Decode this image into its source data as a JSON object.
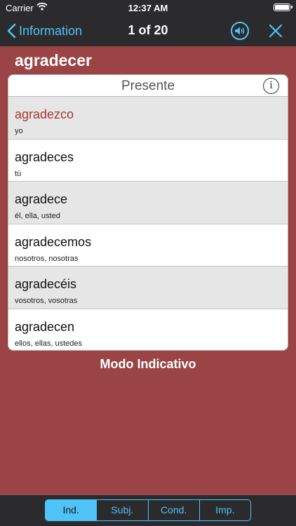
{
  "status_bar": {
    "carrier": "Carrier",
    "time": "12:37 AM"
  },
  "nav": {
    "back_label": "Information",
    "counter": "1 of 20",
    "speaker_icon": "speaker-icon",
    "close_icon": "close-icon"
  },
  "verb": "agradecer",
  "table": {
    "tense": "Presente",
    "info_glyph": "i",
    "rows": [
      {
        "form": "agradezco",
        "pronoun": "yo",
        "irregular": true
      },
      {
        "form": "agradeces",
        "pronoun": "tú",
        "irregular": false
      },
      {
        "form": "agradece",
        "pronoun": "él, ella, usted",
        "irregular": false
      },
      {
        "form": "agradecemos",
        "pronoun": "nosotros, nosotras",
        "irregular": false
      },
      {
        "form": "agradecéis",
        "pronoun": "vosotros, vosotras",
        "irregular": false
      },
      {
        "form": "agradecen",
        "pronoun": "ellos, ellas, ustedes",
        "irregular": false
      }
    ]
  },
  "mode_label": "Modo Indicativo",
  "tabs": [
    {
      "label": "Ind.",
      "selected": true
    },
    {
      "label": "Subj.",
      "selected": false
    },
    {
      "label": "Cond.",
      "selected": false
    },
    {
      "label": "Imp.",
      "selected": false
    }
  ],
  "colors": {
    "background": "#9b4445",
    "bar": "#2b2b2d",
    "accent": "#4fc3f7",
    "irregular_text": "#a3392f"
  }
}
